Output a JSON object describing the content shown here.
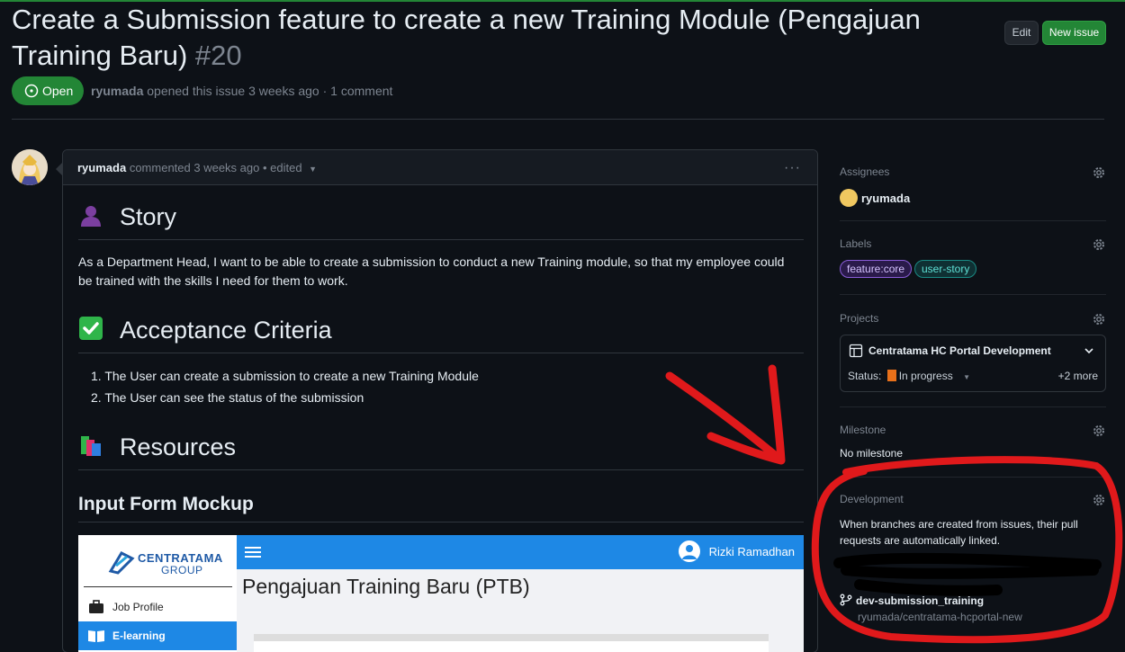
{
  "issue": {
    "title": "Create a Submission feature to create a new Training Module (Pengajuan Training Baru)",
    "number": "#20",
    "state": "Open",
    "author": "ryumada",
    "meta_text": "opened this issue 3 weeks ago · 1 comment"
  },
  "header_buttons": {
    "edit": "Edit",
    "new_issue": "New issue"
  },
  "comment": {
    "author": "ryumada",
    "meta": "commented 3 weeks ago • edited",
    "more": "···",
    "story_heading": "Story",
    "story_text": "As a Department Head, I want to be able to create a submission to conduct a new Training module, so that my employee could be trained with the skills I need for them to work.",
    "acceptance_heading": "Acceptance Criteria",
    "criteria": [
      "The User can create a submission to create a new Training Module",
      "The User can see the status of the submission"
    ],
    "criteria_numbers": [
      "1.",
      "2."
    ],
    "resources_heading": "Resources",
    "mockup_heading": "Input Form Mockup",
    "mockup": {
      "logo_line1": "CENTRATAMA",
      "logo_line2": "GROUP",
      "menu": [
        "Job Profile",
        "E-learning"
      ],
      "user_name": "Rizki Ramadhan",
      "page_title": "Pengajuan Training Baru (PTB)"
    }
  },
  "sidebar": {
    "assignees_label": "Assignees",
    "assignee": "ryumada",
    "labels_label": "Labels",
    "labels": [
      {
        "name": "feature:core",
        "color": "#a371f7"
      },
      {
        "name": "user-story",
        "color": "#2dd4bf"
      }
    ],
    "projects_label": "Projects",
    "project_name": "Centratama HC Portal Development",
    "status_label": "Status:",
    "status_value": "In progress",
    "more": "+2 more",
    "milestone_label": "Milestone",
    "milestone_value": "No milestone",
    "development_label": "Development",
    "development_text": "When branches are created from issues, their pull requests are automatically linked.",
    "branch_name": "dev-submission_training",
    "branch_repo": "ryumada/centratama-hcportal-new"
  },
  "colors": {
    "accent_green": "#238636",
    "annotation_red": "#e0191b"
  }
}
